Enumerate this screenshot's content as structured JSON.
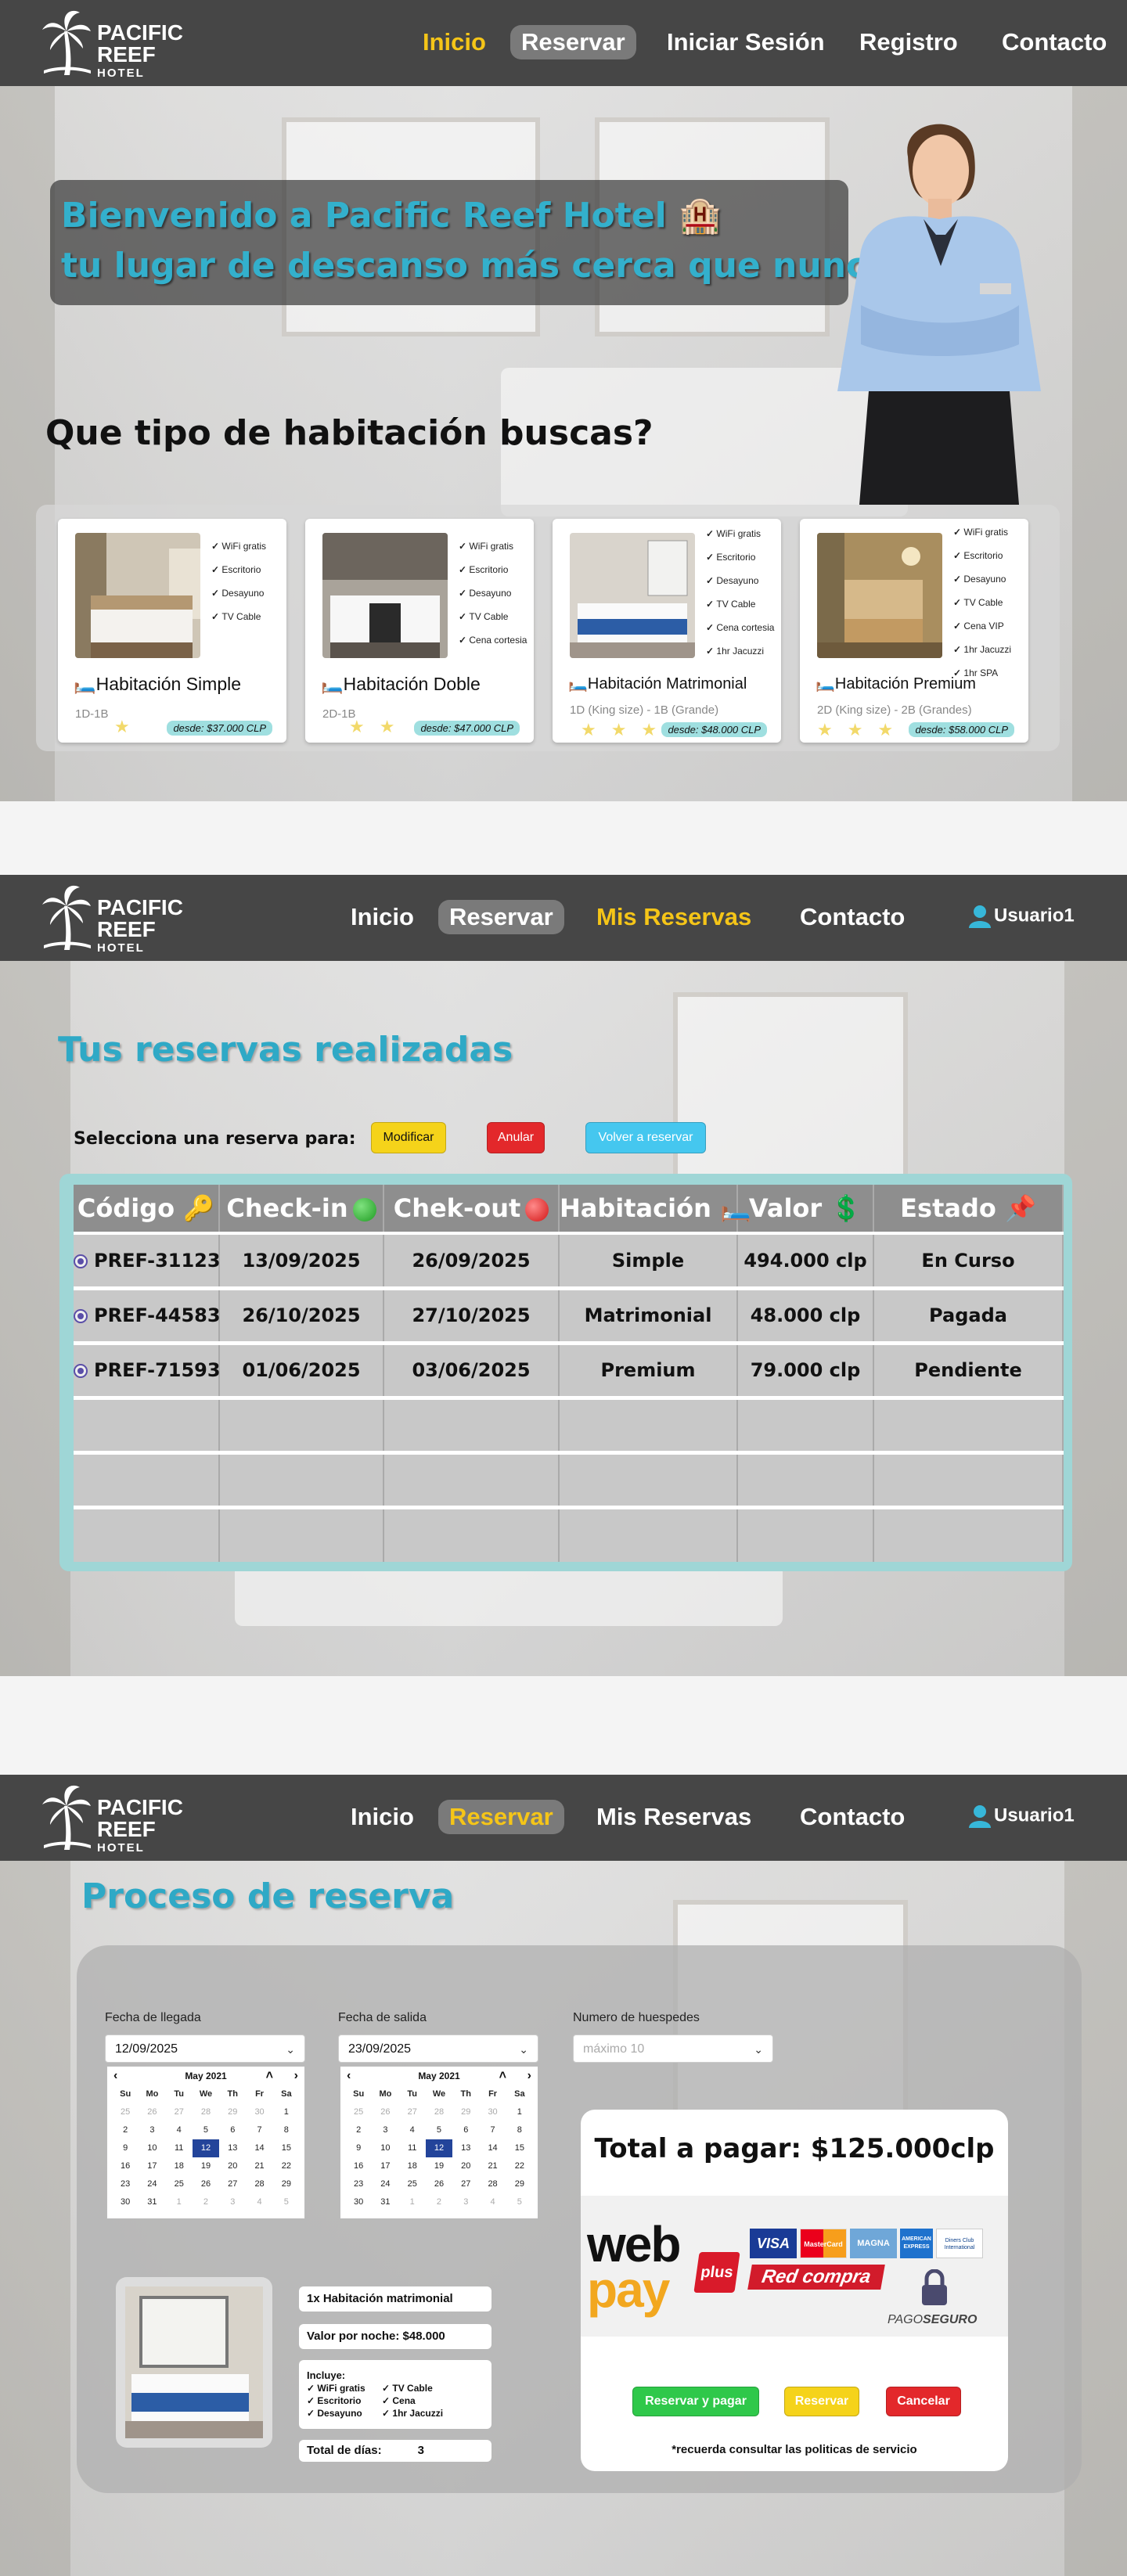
{
  "brand": {
    "line1": "PACIFIC",
    "line2": "REEF",
    "line3": "HOTEL"
  },
  "nav1": {
    "inicio": "Inicio",
    "reservar": "Reservar",
    "login": "Iniciar Sesión",
    "registro": "Registro",
    "contacto": "Contacto"
  },
  "hero": {
    "welcome_line1": "Bienvenido a Pacific Reef Hotel 🏨",
    "welcome_line2": "tu lugar de descanso más cerca que nunca",
    "question": "Que tipo de habitación buscas?"
  },
  "rooms": [
    {
      "name": "🛏️Habitación Simple",
      "beds": "1D-1B",
      "stars": "★",
      "price": "desde: $37.000 CLP",
      "amenities": [
        "WiFi gratis",
        "Escritorio",
        "Desayuno",
        "TV Cable"
      ]
    },
    {
      "name": "🛏️Habitación Doble",
      "beds": "2D-1B",
      "stars": "★ ★",
      "price": "desde: $47.000 CLP",
      "amenities": [
        "WiFi gratis",
        "Escritorio",
        "Desayuno",
        "TV Cable",
        "Cena cortesia"
      ]
    },
    {
      "name": "🛏️Habitación Matrimonial",
      "beds": "1D (King size) - 1B (Grande)",
      "stars": "★ ★ ★",
      "price": "desde: $48.000 CLP",
      "amenities": [
        "WiFi gratis",
        "Escritorio",
        "Desayuno",
        "TV Cable",
        "Cena cortesia",
        "1hr Jacuzzi"
      ]
    },
    {
      "name": "🛏️Habitación Premium",
      "beds": "2D (King size) - 2B (Grandes)",
      "stars": "★ ★ ★ ★",
      "price": "desde: $58.000 CLP",
      "amenities": [
        "WiFi gratis",
        "Escritorio",
        "Desayuno",
        "TV Cable",
        "Cena VIP",
        "1hr Jacuzzi",
        "1hr SPA"
      ]
    }
  ],
  "nav2": {
    "inicio": "Inicio",
    "reservar": "Reservar",
    "mis_reservas": "Mis Reservas",
    "contacto": "Contacto",
    "user": "Usuario1"
  },
  "reservas": {
    "title": "Tus reservas realizadas",
    "select_label": "Selecciona una reserva para:",
    "btn_modificar": "Modificar",
    "btn_anular": "Anular",
    "btn_volver": "Volver a reservar",
    "headers": [
      "Código 🔑",
      "Check-in",
      "Chek-out",
      "Habitación 🛏️",
      "Valor 💲",
      "Estado 📌"
    ],
    "rows": [
      [
        "PREF-31123",
        "13/09/2025",
        "26/09/2025",
        "Simple",
        "494.000 clp",
        "En Curso"
      ],
      [
        "PREF-44583",
        "26/10/2025",
        "27/10/2025",
        "Matrimonial",
        "48.000 clp",
        "Pagada"
      ],
      [
        "PREF-71593",
        "01/06/2025",
        "03/06/2025",
        "Premium",
        "79.000 clp",
        "Pendiente"
      ]
    ]
  },
  "nav3": {
    "inicio": "Inicio",
    "reservar": "Reservar",
    "mis_reservas": "Mis Reservas",
    "contacto": "Contacto",
    "user": "Usuario1"
  },
  "proceso": {
    "title": "Proceso de reserva",
    "llegada_label": "Fecha de llegada",
    "llegada_value": "12/09/2025",
    "salida_label": "Fecha de salida",
    "salida_value": "23/09/2025",
    "huespedes_label": "Numero de huespedes",
    "huespedes_placeholder": "máximo 10",
    "cal_month": "May 2021",
    "cal_dow": [
      "Su",
      "Mo",
      "Tu",
      "We",
      "Th",
      "Fr",
      "Sa"
    ],
    "cal_days": [
      "25",
      "26",
      "27",
      "28",
      "29",
      "30",
      "1",
      "2",
      "3",
      "4",
      "5",
      "6",
      "7",
      "8",
      "9",
      "10",
      "11",
      "12",
      "13",
      "14",
      "15",
      "16",
      "17",
      "18",
      "19",
      "20",
      "21",
      "22",
      "23",
      "24",
      "25",
      "26",
      "27",
      "28",
      "29",
      "30",
      "31",
      "1",
      "2",
      "3",
      "4",
      "5"
    ],
    "cal_selected": "12",
    "total": "Total a pagar: $125.000clp",
    "webpay_web": "web",
    "webpay_pay": "pay",
    "webpay_plus": "plus",
    "card_visa": "VISA",
    "card_master": "MasterCard",
    "card_magna": "MAGNA",
    "card_amex": "AMERICAN EXPRESS",
    "card_diners": "Diners Club International",
    "redcompra": "Red compra",
    "pago_seguro_1": "PAGO",
    "pago_seguro_2": "SEGURO",
    "btn_pagar": "Reservar y pagar",
    "btn_reservar": "Reservar",
    "btn_cancelar": "Cancelar",
    "note": "*recuerda consultar las politicas de servicio",
    "habitacion": "1x Habitación matrimonial",
    "valor_label": "Valor por noche:",
    "valor": "$48.000",
    "incluye": "Incluye:",
    "incluye_items": [
      "WiFi gratis",
      "TV Cable",
      "Escritorio",
      "Cena",
      "Desayuno",
      "1hr Jacuzzi"
    ],
    "dias_label": "Total de días:",
    "dias": "3"
  },
  "colors": {
    "accent": "#2fa9c6",
    "nav_bg": "#464646",
    "nav_yellow": "#f5c518",
    "table_border": "#9fd6d6"
  }
}
